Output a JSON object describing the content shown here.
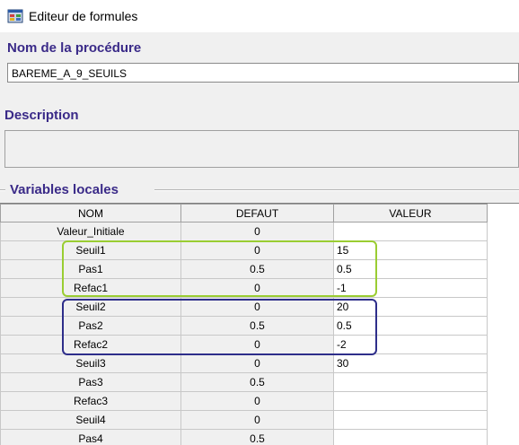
{
  "window": {
    "title": "Editeur de formules"
  },
  "procedure": {
    "label": "Nom de la procédure",
    "value": "BAREME_A_9_SEUILS"
  },
  "description": {
    "label": "Description",
    "value": ""
  },
  "variables": {
    "label": "Variables locales",
    "columns": [
      "NOM",
      "DEFAUT",
      "VALEUR"
    ],
    "rows": [
      {
        "nom": "Valeur_Initiale",
        "defaut": "0",
        "valeur": ""
      },
      {
        "nom": "Seuil1",
        "defaut": "0",
        "valeur": "15"
      },
      {
        "nom": "Pas1",
        "defaut": "0.5",
        "valeur": "0.5"
      },
      {
        "nom": "Refac1",
        "defaut": "0",
        "valeur": "-1"
      },
      {
        "nom": "Seuil2",
        "defaut": "0",
        "valeur": "20"
      },
      {
        "nom": "Pas2",
        "defaut": "0.5",
        "valeur": "0.5"
      },
      {
        "nom": "Refac2",
        "defaut": "0",
        "valeur": "-2"
      },
      {
        "nom": "Seuil3",
        "defaut": "0",
        "valeur": "30"
      },
      {
        "nom": "Pas3",
        "defaut": "0.5",
        "valeur": ""
      },
      {
        "nom": "Refac3",
        "defaut": "0",
        "valeur": ""
      },
      {
        "nom": "Seuil4",
        "defaut": "0",
        "valeur": ""
      },
      {
        "nom": "Pas4",
        "defaut": "0.5",
        "valeur": ""
      }
    ]
  },
  "highlights": [
    {
      "name": "highlight-group-1",
      "color": "#9acd32"
    },
    {
      "name": "highlight-group-2",
      "color": "#2e2e8a"
    }
  ]
}
